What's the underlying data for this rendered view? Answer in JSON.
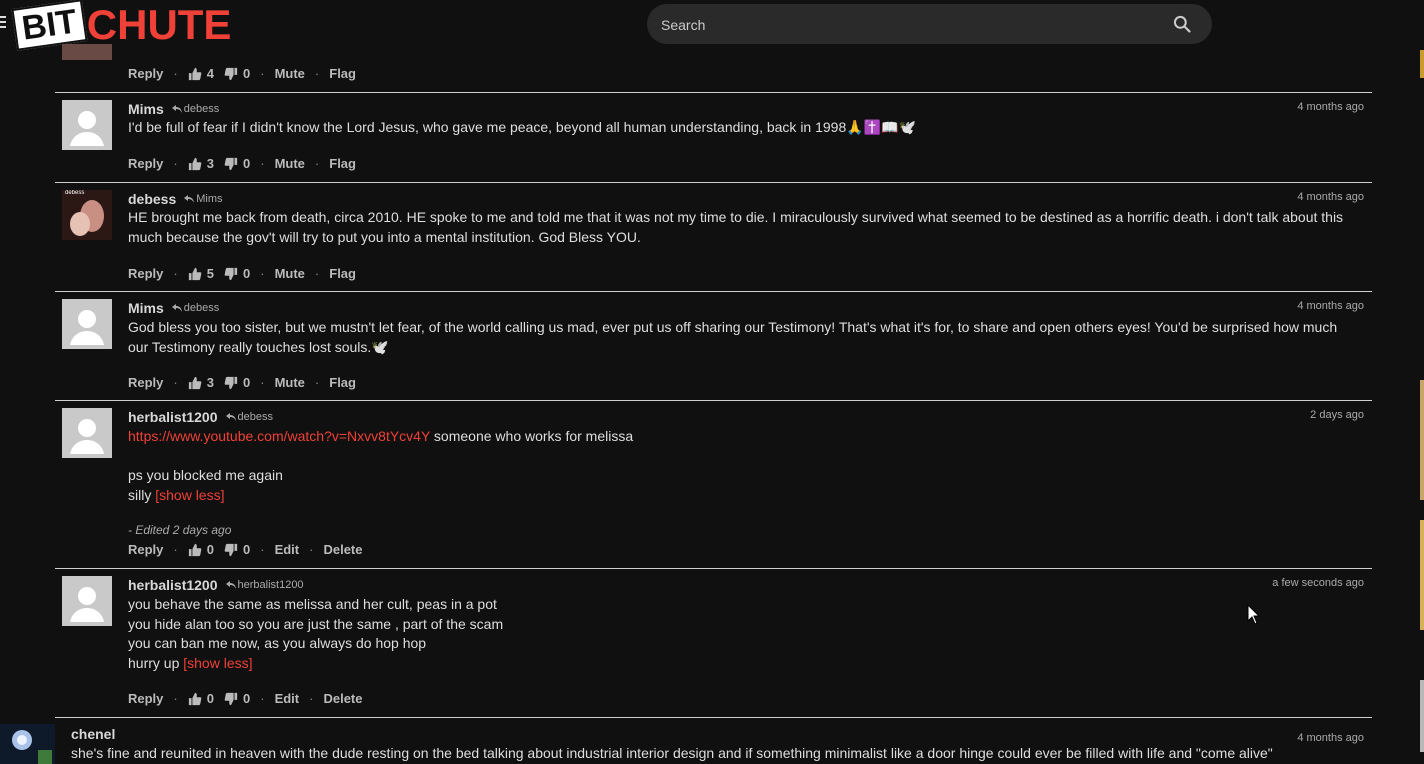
{
  "header": {
    "logo_bit": "BIT",
    "logo_chute": "CHUTE",
    "search_placeholder": "Search"
  },
  "top_actions": {
    "reply": "Reply",
    "likes": "4",
    "dislikes": "0",
    "mute": "Mute",
    "flag": "Flag"
  },
  "comments": [
    {
      "author": "Mims",
      "reply_to": "debess",
      "time": "4 months ago",
      "text": "I'd be full of fear if I didn't know the Lord Jesus, who gave me peace, beyond all human understanding, back in 1998🙏✝️📖🕊️",
      "likes": "3",
      "dislikes": "0",
      "reply": "Reply",
      "action1": "Mute",
      "action2": "Flag"
    },
    {
      "author": "debess",
      "reply_to": "Mims",
      "time": "4 months ago",
      "avatar_label": "debess",
      "text": "HE brought me back from death, circa 2010. HE spoke to me and told me that it was not my time to die. I miraculously survived what seemed to be destined as a horrific death. i don't talk about this much because the gov't will try to put you into a mental institution. God Bless YOU.",
      "likes": "5",
      "dislikes": "0",
      "reply": "Reply",
      "action1": "Mute",
      "action2": "Flag"
    },
    {
      "author": "Mims",
      "reply_to": "debess",
      "time": "4 months ago",
      "text": "God bless you too sister, but we mustn't let fear, of the world calling us mad, ever put us off sharing our Testimony! That's what it's for, to share and open others eyes! You'd be surprised how much our Testimony really touches lost souls.🕊️",
      "likes": "3",
      "dislikes": "0",
      "reply": "Reply",
      "action1": "Mute",
      "action2": "Flag"
    },
    {
      "author": "herbalist1200",
      "reply_to": "debess",
      "time": "2 days ago",
      "link": "https://www.youtube.com/watch?v=Nxvv8tYcv4Y",
      "line1_rest": " someone who works for melissa",
      "line2": "ps you blocked me again",
      "line3": "silly ",
      "show_less": "[show less]",
      "edited": "- Edited 2 days ago",
      "likes": "0",
      "dislikes": "0",
      "reply": "Reply",
      "action1": "Edit",
      "action2": "Delete"
    },
    {
      "author": "herbalist1200",
      "reply_to": "herbalist1200",
      "time": "a few seconds ago",
      "line1": "you behave the same as melissa and her cult, peas in a pot",
      "line2": "you hide alan too so you are just the same , part of the scam",
      "line3": "you can ban me now, as you always do hop hop",
      "line4": "hurry up ",
      "show_less": "[show less]",
      "likes": "0",
      "dislikes": "0",
      "reply": "Reply",
      "action1": "Edit",
      "action2": "Delete"
    }
  ],
  "last_comment": {
    "author": "chenel",
    "time": "4 months ago",
    "text": "she's fine and reunited in heaven with the dude resting on the bed talking about industrial interior design and if something minimalist like a door hinge could ever be filled with life and \"come alive\""
  }
}
